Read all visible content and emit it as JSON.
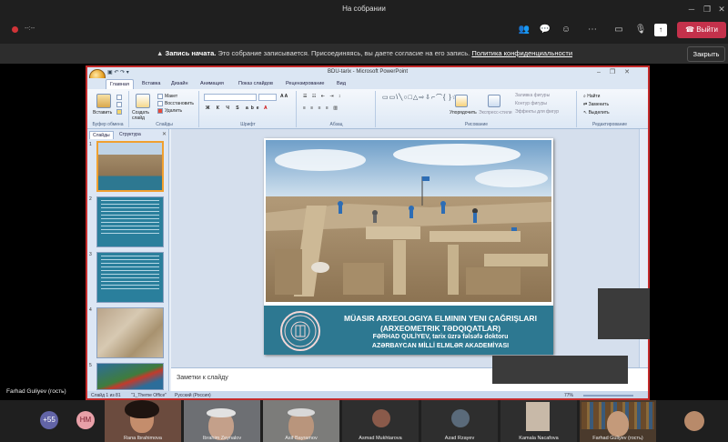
{
  "window": {
    "title": "На собрании"
  },
  "meeting": {
    "timer": "--:--",
    "leave_label": "Выйти",
    "banner": {
      "strong": "Запись начата.",
      "text": "Это собрание записывается. Присоединяясь, вы даете согласие на его запись.",
      "link": "Политика конфиденциальности",
      "close_label": "Закрыть"
    },
    "presenter_name": "Farhad Guliyev (гость)"
  },
  "ppt": {
    "title": "BDU-tarix - Microsoft PowerPoint",
    "tabs": [
      "Главная",
      "Вставка",
      "Дизайн",
      "Анимация",
      "Показ слайдов",
      "Рецензирование",
      "Вид"
    ],
    "ribbon": {
      "paste": "Вставить",
      "new_slide": "Создать слайд",
      "layout": "Макет",
      "reset": "Восстановить",
      "delete": "Удалить",
      "arrange": "Упорядочить",
      "quick_styles": "Экспресс-стили",
      "shape_fill": "Заливка фигуры",
      "shape_outline": "Контур фигуры",
      "shape_effects": "Эффекты для фигур",
      "find": "Найти",
      "replace": "Заменить",
      "select": "Выделить",
      "groups": [
        "Буфер обмена",
        "Слайды",
        "Шрифт",
        "Абзац",
        "Рисование",
        "Редактирование"
      ]
    },
    "panel_tabs": [
      "Слайды",
      "Структура"
    ],
    "thumb_numbers": [
      "1",
      "2",
      "3",
      "4",
      "5"
    ],
    "slide": {
      "line1": "MÜASIR ARXEOLOGIYA ELMININ YENI ÇAĞRIŞLARI",
      "line2": "(ARXEOMETRIK TƏDQIQATLAR)",
      "line3": "FƏRHAD QULİYEV, tarix üzrə fəlsəfə doktoru",
      "line4": "AZƏRBAYCAN MİLLİ ELMLƏR AKADEMİYASI"
    },
    "notes_placeholder": "Заметки к слайду",
    "status": {
      "slide": "Слайд 1 из 81",
      "theme": "\"1_Theme Office\"",
      "lang": "Русский (Россия)",
      "zoom": "77%"
    }
  },
  "participants": {
    "overflow": "+55",
    "initials": "НМ",
    "people": [
      "Rana Ibrahimova",
      "Ibrahim Zeynalov",
      "Asif Bayramov",
      "Asmad Mukhtarova",
      "Azad Rzayev",
      "Kamala Nacafova",
      "Farhad Guliyev (гость)"
    ]
  },
  "colors": {
    "leave": "#c4314b",
    "ppt_frame": "#c42b2b",
    "slide_banner": "#2d7891"
  }
}
